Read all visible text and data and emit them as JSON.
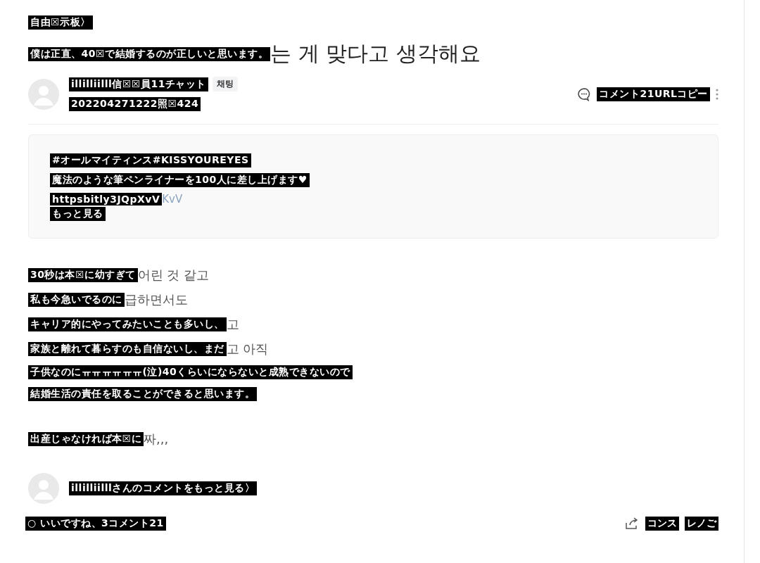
{
  "breadcrumb": "自由☒示板〉",
  "title": {
    "overlay": "僕は正直、40☒で結婚するのが正しいと思います。",
    "remainder": "는 게 맞다고 생각해요"
  },
  "author": {
    "name": "illilliilll信☒☒員11チャット",
    "badge": "채팅",
    "meta": "202204271222照☒424"
  },
  "header_actions": {
    "comments": "コメント21URLコピー"
  },
  "promo": {
    "lines": [
      "#オールマイティンス#KISSYOUREYES",
      "魔法のような筆ペンライナーを100人に差し上げます♥"
    ],
    "link": {
      "overlay": "httpsbitly3JQpXvV",
      "remainder": "KvV"
    },
    "more": "もっと見る"
  },
  "body": [
    {
      "lines": [
        {
          "overlay": "30秒は本☒に幼すぎて",
          "remainder": "어린 것 같고"
        },
        {
          "overlay": "私も今急いでるのに",
          "remainder": "급하면서도"
        },
        {
          "overlay": "キャリア的にやってみたいことも多いし、",
          "remainder": "고"
        },
        {
          "overlay": "家族と離れて暮らすのも自信ないし、まだ",
          "remainder": "고 아직"
        },
        {
          "overlay": "子供なのにㅠㅠㅠㅠㅠㅠ(泣)40くらいにならないと成熟できないので"
        },
        {
          "overlay": "結婚生活の責任を取ることができると思います。"
        }
      ]
    },
    {
      "lines": [
        {
          "overlay": "出産じゃなければ本☒に",
          "remainder": "짜,,,"
        }
      ]
    }
  ],
  "author_more": "illilliilllさんのコメントをもっと見る〉",
  "footer": {
    "stats": "○ いいですね、3コメント21",
    "buttons": [
      "コンス",
      "レノご"
    ]
  }
}
